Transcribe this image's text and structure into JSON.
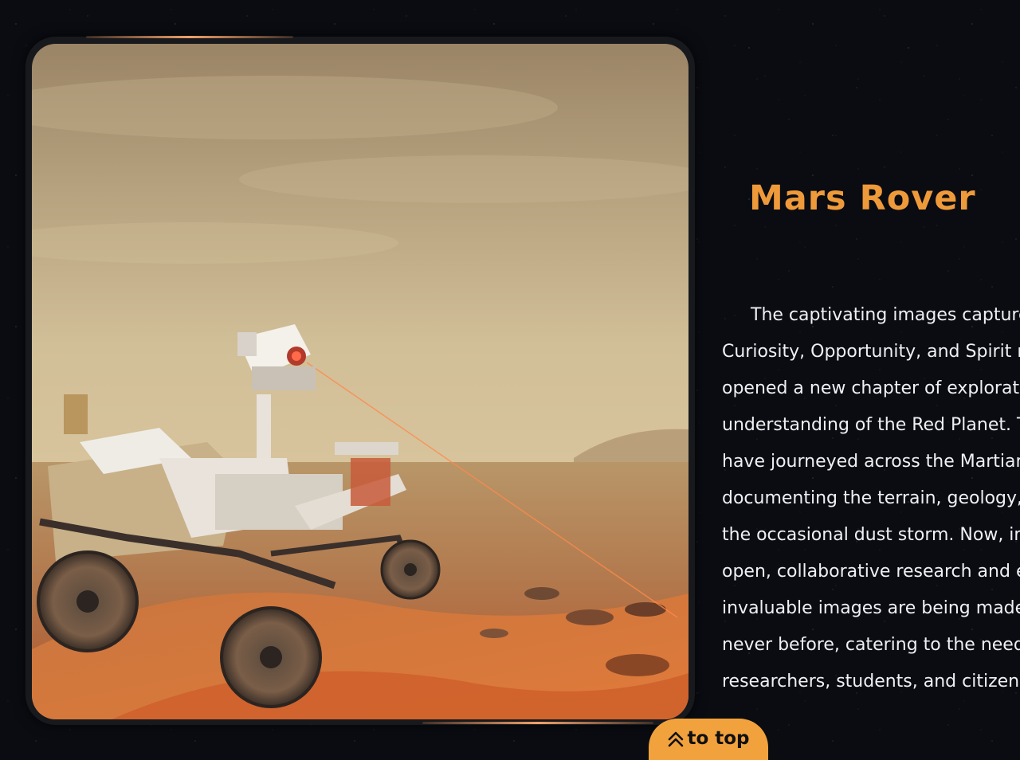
{
  "hero": {
    "title": "Mars Rover",
    "description": "The captivating images captured by the Curiosity, Opportunity, and Spirit rovers have opened a new chapter of exploration and understanding of the Red Planet. These rovers have journeyed across the Martian surface, documenting the terrain, geology, sky and even the occasional dust storm. Now, in the spirit of open, collaborative research and education, these invaluable images are being made accessible like never before, catering to the needs of researchers, students, and citizen scientists alike.",
    "image_icon": "mars-rover-photo"
  },
  "to_top": {
    "label": "to top",
    "icon": "double-chevron-up-icon"
  },
  "colors": {
    "accent": "#ef9a3a",
    "button": "#f2a23d",
    "background": "#0a0c12",
    "frame": "#17191d"
  }
}
